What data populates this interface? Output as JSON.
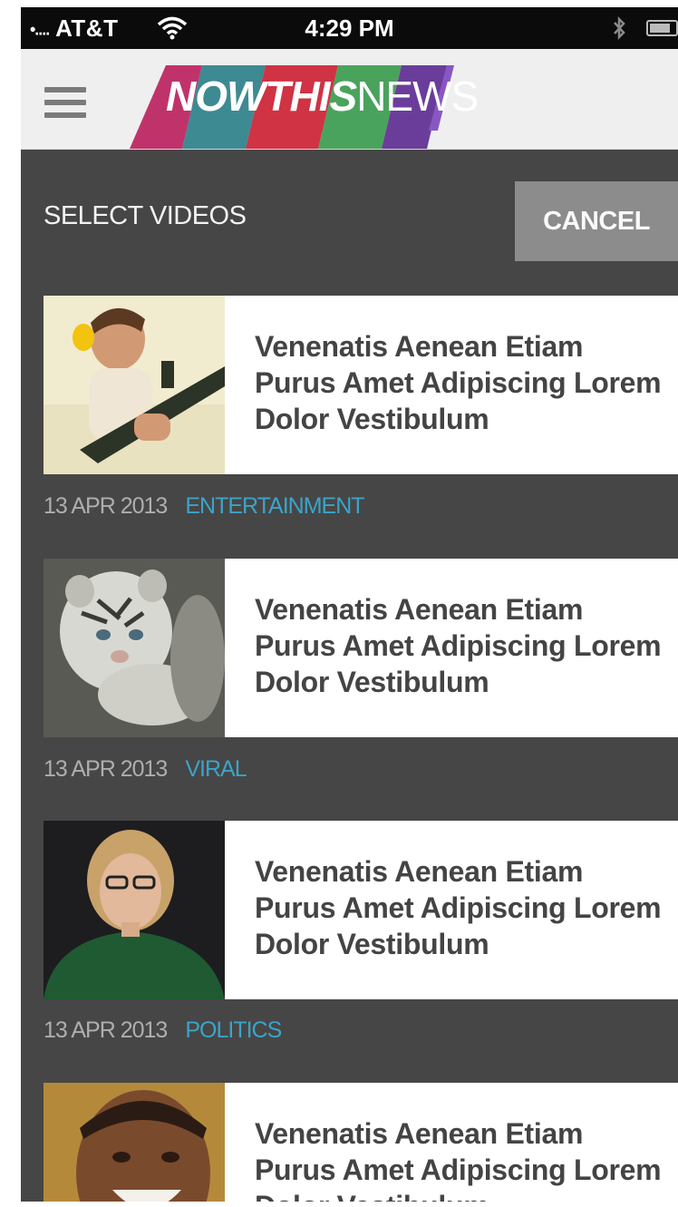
{
  "status_bar": {
    "carrier": "AT&T",
    "signal_dots": "•....",
    "time": "4:29 PM"
  },
  "header": {
    "logo_bold": "NOWTHIS",
    "logo_light": "NEWS",
    "menu_icon": "hamburger-menu-icon"
  },
  "selection": {
    "label": "SELECT VIDEOS",
    "cancel_label": "CANCEL"
  },
  "videos": [
    {
      "title": "Venenatis Aenean Etiam Purus Amet Adipiscing Lorem Dolor Vestibulum",
      "date": "13 APR 2013",
      "category": "ENTERTAINMENT",
      "thumbnail": "man-with-rifle-image"
    },
    {
      "title": "Venenatis Aenean Etiam Purus Amet Adipiscing Lorem Dolor Vestibulum",
      "date": "13 APR 2013",
      "category": "VIRAL",
      "thumbnail": "white-tiger-cub-image"
    },
    {
      "title": "Venenatis Aenean Etiam Purus Amet Adipiscing Lorem Dolor Vestibulum",
      "date": "13 APR 2013",
      "category": "POLITICS",
      "thumbnail": "woman-in-green-image"
    },
    {
      "title": "Venenatis Aenean Etiam Purus Amet Adipiscing Lorem Dolor Vestibulum",
      "date": "",
      "category": "",
      "thumbnail": "smiling-man-image"
    }
  ],
  "colors": {
    "background": "#464646",
    "card": "#ffffff",
    "category_accent": "#3ba4c8",
    "cancel_button": "#8c8c8c"
  }
}
